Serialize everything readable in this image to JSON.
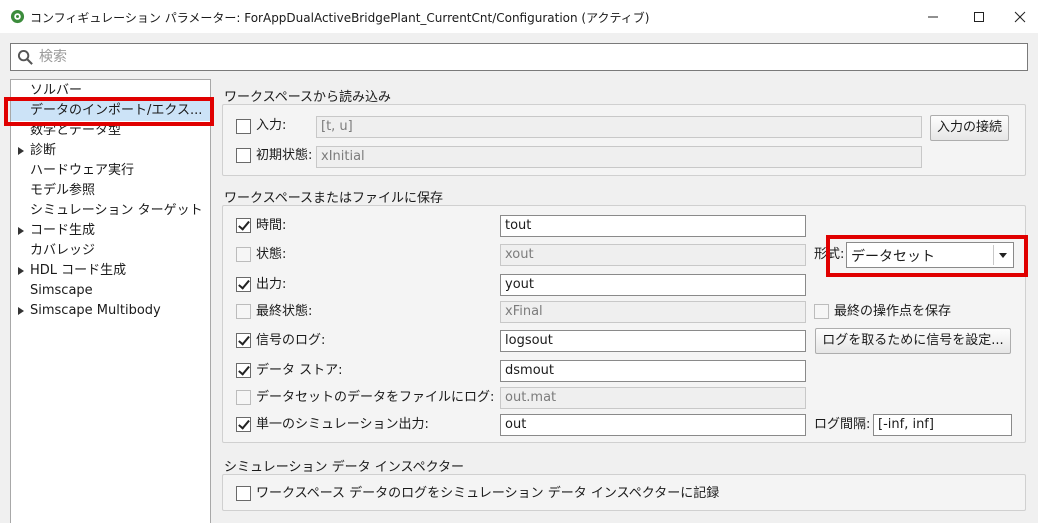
{
  "window": {
    "title": "コンフィギュレーション パラメーター: ForAppDualActiveBridgePlant_CurrentCnt/Configuration (アクティブ)",
    "controls": [
      "minimize-icon",
      "maximize-icon",
      "close-icon"
    ]
  },
  "search": {
    "placeholder": "検索"
  },
  "tree": {
    "items": [
      {
        "label": "ソルバー",
        "expandable": false,
        "selected": false
      },
      {
        "label": "データのインポート/エクス...",
        "expandable": false,
        "selected": true
      },
      {
        "label": "数学とデータ型",
        "expandable": false,
        "selected": false
      },
      {
        "label": "診断",
        "expandable": true,
        "selected": false
      },
      {
        "label": "ハードウェア実行",
        "expandable": false,
        "selected": false
      },
      {
        "label": "モデル参照",
        "expandable": false,
        "selected": false
      },
      {
        "label": "シミュレーション ターゲット",
        "expandable": false,
        "selected": false
      },
      {
        "label": "コード生成",
        "expandable": true,
        "selected": false
      },
      {
        "label": "カバレッジ",
        "expandable": false,
        "selected": false
      },
      {
        "label": "HDL コード生成",
        "expandable": true,
        "selected": false
      },
      {
        "label": "Simscape",
        "expandable": false,
        "selected": false
      },
      {
        "label": "Simscape Multibody",
        "expandable": true,
        "selected": false
      }
    ]
  },
  "load": {
    "title": "ワークスペースから読み込み",
    "input": {
      "label": "入力:",
      "checked": false,
      "value": "[t, u]"
    },
    "initial_state": {
      "label": "初期状態:",
      "checked": false,
      "value": "xInitial"
    },
    "connect_button": "入力の接続"
  },
  "save": {
    "title": "ワークスペースまたはファイルに保存",
    "rows": {
      "time": {
        "label": "時間:",
        "checked": true,
        "value": "tout"
      },
      "states": {
        "label": "状態:",
        "checked": false,
        "value": "xout"
      },
      "output": {
        "label": "出力:",
        "checked": true,
        "value": "yout"
      },
      "final_states": {
        "label": "最終状態:",
        "checked": false,
        "value": "xFinal"
      },
      "signal_logging": {
        "label": "信号のログ:",
        "checked": true,
        "value": "logsout"
      },
      "data_stores": {
        "label": "データ ストア:",
        "checked": true,
        "value": "dsmout"
      },
      "dataset_to_file": {
        "label": "データセットのデータをファイルにログ:",
        "checked": false,
        "value": "out.mat"
      },
      "single_output": {
        "label": "単一のシミュレーション出力:",
        "checked": true,
        "value": "out"
      }
    },
    "format_label": "形式:",
    "format_value": "データセット",
    "save_op_point": {
      "label": "最終の操作点を保存",
      "checked": false
    },
    "config_signals_button": "ログを取るために信号を設定...",
    "log_interval_label": "ログ間隔:",
    "log_interval_value": "[-inf, inf]"
  },
  "sdi": {
    "title": "シミュレーション データ インスペクター",
    "record": {
      "label": "ワークスペース データのログをシミュレーション データ インスペクターに記録",
      "checked": false
    }
  }
}
